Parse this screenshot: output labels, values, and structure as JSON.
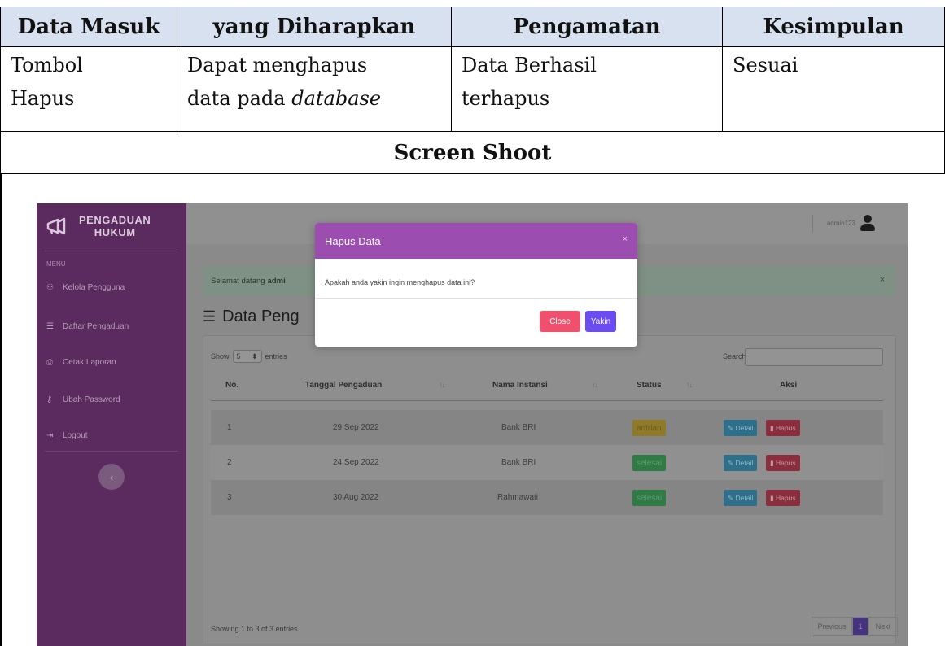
{
  "document": {
    "headers": [
      "Data Masuk",
      "yang Diharapkan",
      "Pengamatan",
      "Kesimpulan"
    ],
    "row": {
      "data_masuk": [
        "Tombol",
        "Hapus"
      ],
      "harapan_line1": "Dapat menghapus",
      "harapan_line2_plain": "data pada ",
      "harapan_line2_italic": "database",
      "pengamatan": [
        "Data Berhasil",
        "terhapus"
      ],
      "kesimpulan": "Sesuai"
    },
    "screenshot_heading": "Screen Shoot"
  },
  "app": {
    "brand_line1": "PENGADUAN",
    "brand_line2": "HUKUM",
    "brand_icon": "megaphone-icon",
    "menu_label": "MENU",
    "menu": [
      {
        "label": "Kelola Pengguna",
        "icon": "users-icon"
      },
      {
        "label": "Daftar Pengaduan",
        "icon": "list-icon"
      },
      {
        "label": "Cetak Laporan",
        "icon": "print-icon"
      },
      {
        "label": "Ubah Password",
        "icon": "key-icon"
      },
      {
        "label": "Logout",
        "icon": "logout-icon"
      }
    ],
    "sidebar_toggle": "‹",
    "user": "admin123",
    "alert": {
      "text": "Selamat datang",
      "bold": "admi",
      "close": "×"
    },
    "page_title": "Data Peng",
    "table": {
      "show_label": "Show",
      "show_value": "5",
      "entries_label": "entries",
      "search_label": "Search:",
      "headers": [
        "No.",
        "Tanggal Pengaduan",
        "Nama Instansi",
        "Status",
        "Aksi"
      ],
      "rows": [
        {
          "no": "1",
          "tanggal": "29 Sep 2022",
          "instansi": "Bank BRI",
          "status": "antrian"
        },
        {
          "no": "2",
          "tanggal": "24 Sep 2022",
          "instansi": "Bank BRI",
          "status": "selesai"
        },
        {
          "no": "3",
          "tanggal": "30 Aug 2022",
          "instansi": "Rahmawati",
          "status": "selesai"
        }
      ],
      "detail_label": "Detail",
      "hapus_label": "Hapus",
      "showing": "Showing 1 to 3 of 3 entries",
      "pagination": {
        "prev": "Previous",
        "current": "1",
        "next": "Next"
      }
    },
    "modal": {
      "title": "Hapus Data",
      "close_x": "×",
      "body": "Apakah anda yakin ingin menghapus data ini?",
      "btn_close": "Close",
      "btn_yakin": "Yakin",
      "header_color": "#9b4db0"
    }
  }
}
